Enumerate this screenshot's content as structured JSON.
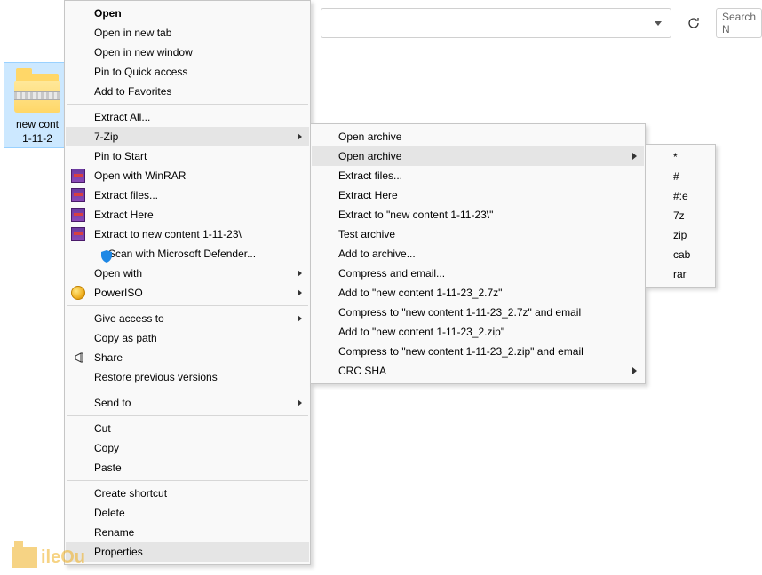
{
  "addressbar": {},
  "search": {
    "placeholder": "Search N"
  },
  "file": {
    "name_line1": "new cont",
    "name_line2": "1-11-2"
  },
  "menu1": {
    "open": "Open",
    "open_new_tab": "Open in new tab",
    "open_new_window": "Open in new window",
    "pin_quick_access": "Pin to Quick access",
    "add_favorites": "Add to Favorites",
    "extract_all": "Extract All...",
    "sevenzip": "7-Zip",
    "pin_to_start": "Pin to Start",
    "open_winrar": "Open with WinRAR",
    "extract_files": "Extract files...",
    "extract_here": "Extract Here",
    "extract_to_folder": "Extract to new content 1-11-23\\",
    "scan_defender": "Scan with Microsoft Defender...",
    "open_with": "Open with",
    "poweriso": "PowerISO",
    "give_access": "Give access to",
    "copy_as_path": "Copy as path",
    "share": "Share",
    "restore_versions": "Restore previous versions",
    "send_to": "Send to",
    "cut": "Cut",
    "copy": "Copy",
    "paste": "Paste",
    "create_shortcut": "Create shortcut",
    "delete": "Delete",
    "rename": "Rename",
    "properties": "Properties"
  },
  "menu2": {
    "open_archive": "Open archive",
    "open_archive2": "Open archive",
    "extract_files": "Extract files...",
    "extract_here": "Extract Here",
    "extract_to": "Extract to \"new content 1-11-23\\\"",
    "test_archive": "Test archive",
    "add_to_archive": "Add to archive...",
    "compress_email": "Compress and email...",
    "add_to_7z": "Add to \"new content 1-11-23_2.7z\"",
    "compress_7z_email": "Compress to \"new content 1-11-23_2.7z\" and email",
    "add_to_zip": "Add to \"new content 1-11-23_2.zip\"",
    "compress_zip_email": "Compress to \"new content 1-11-23_2.zip\" and email",
    "crc_sha": "CRC SHA"
  },
  "menu3": {
    "star": "*",
    "hash": "#",
    "hash_e": "#:e",
    "sevenz": "7z",
    "zip": "zip",
    "cab": "cab",
    "rar": "rar"
  },
  "watermark": {
    "text": "ileOu"
  }
}
